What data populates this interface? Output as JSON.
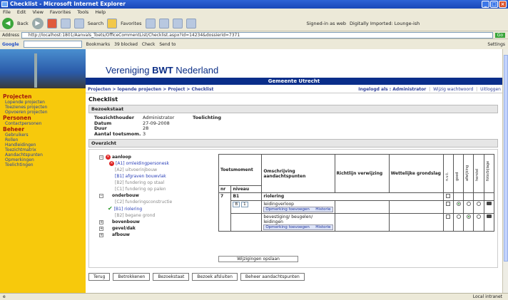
{
  "window": {
    "title": "Checklist - Microsoft Internet Explorer"
  },
  "menu": [
    "File",
    "Edit",
    "View",
    "Favorites",
    "Tools",
    "Help"
  ],
  "toolbar": {
    "back": "Back",
    "search": "Search",
    "favorites": "Favorites",
    "right1": "Signed-in as web",
    "right2": "Digitally Imported: Lounge-ish"
  },
  "address": {
    "label": "Address",
    "url": "http://localhost:1801/Aanvals_Toets/OfficeCommentList/Checklist.aspx?id=14234&dossierid=7371",
    "go": "Go"
  },
  "google": {
    "label": "Google",
    "bookmarks": "Bookmarks",
    "blocked": "39 blocked",
    "check": "Check",
    "sendto": "Send to",
    "settings": "Settings"
  },
  "header": {
    "org_prefix": "Vereniging ",
    "org_bold": "BWT",
    "org_suffix": " Nederland",
    "municipality": "Gemeente Utrecht"
  },
  "breadcrumb": "Projecten > lopende projecten > Project > Checklist",
  "userbar": {
    "logged_in": "Ingelogd als : Administrator",
    "change_pw": "Wijzig wachtwoord",
    "logout": "Uitloggen"
  },
  "sidebar": {
    "projects_title": "Projecten",
    "projects": [
      "Lopende projecten",
      "Toezienes projecten",
      "Opvoeren projecten"
    ],
    "people_title": "Personen",
    "people": [
      "Contactpersonen"
    ],
    "admin_title": "Beheer",
    "admin": [
      "Gebruikers",
      "Rollen",
      "Handleidingen",
      "Toezichtmatrix",
      "Aandachtspunten",
      "Opmerkingen",
      "Toelichtingen"
    ]
  },
  "page": {
    "title": "Checklist",
    "status_panel": "Bezoekstaat",
    "info": [
      {
        "label": "Toezichthouder",
        "value": "Administrator",
        "extra": "Toelichting"
      },
      {
        "label": "Datum",
        "value": "27-09-2008",
        "extra": ""
      },
      {
        "label": "Duur",
        "value": "28",
        "extra": ""
      },
      {
        "label": "Aantal toetsmom.",
        "value": "3",
        "extra": ""
      }
    ],
    "overview_panel": "Overzicht",
    "tree": [
      {
        "kind": "group",
        "label": "aanloop"
      },
      {
        "kind": "xlink",
        "label": "[A1] omleidingpersonesk"
      },
      {
        "kind": "muted",
        "label": "[A2] uitvoerinjbouw"
      },
      {
        "kind": "link",
        "label": "[B1] afgraven bouwvlak"
      },
      {
        "kind": "muted",
        "label": "[B2] fundering op staal"
      },
      {
        "kind": "muted",
        "label": "[C1] fundering op palen"
      },
      {
        "kind": "group2",
        "label": "onderbouw"
      },
      {
        "kind": "muted",
        "label": "[C2] funderingsconstructie"
      },
      {
        "kind": "check",
        "label": "[B1] riolering"
      },
      {
        "kind": "muted",
        "label": "[B2] begane grond"
      },
      {
        "kind": "group2",
        "label": "bovenbouw"
      },
      {
        "kind": "group2",
        "label": "gevel/dak"
      },
      {
        "kind": "group2",
        "label": "afbouw"
      }
    ],
    "table": {
      "headers": {
        "moment": "Toetsmoment",
        "desc": "Omschrijving aandachtspunten",
        "guide": "Richtlijn verwijzing",
        "law": "Wettelijke grondslag",
        "nr": "nr",
        "level": "niveau"
      },
      "vertical": [
        "n.v.t.",
        "goed",
        "afwijking",
        "herstel",
        "foto/bijlage"
      ],
      "row_nr": "7",
      "row_level": "B1",
      "row_title": "riolering",
      "item1": "leidingverloop",
      "item2": "bevestiging/ beugelen/ leidingen",
      "add_remark": "Opmerking toevoegen",
      "history": "Historie",
      "sel1": "B",
      "sel2": "1"
    },
    "save_button": "Wijzigingen opslaan",
    "bottom_buttons": [
      "Terug",
      "Betrokkenen",
      "Bezoekstaat",
      "Bezoek afsluiten",
      "Beheer aandachtspunten"
    ]
  },
  "status": {
    "zone": "Local intranet"
  }
}
